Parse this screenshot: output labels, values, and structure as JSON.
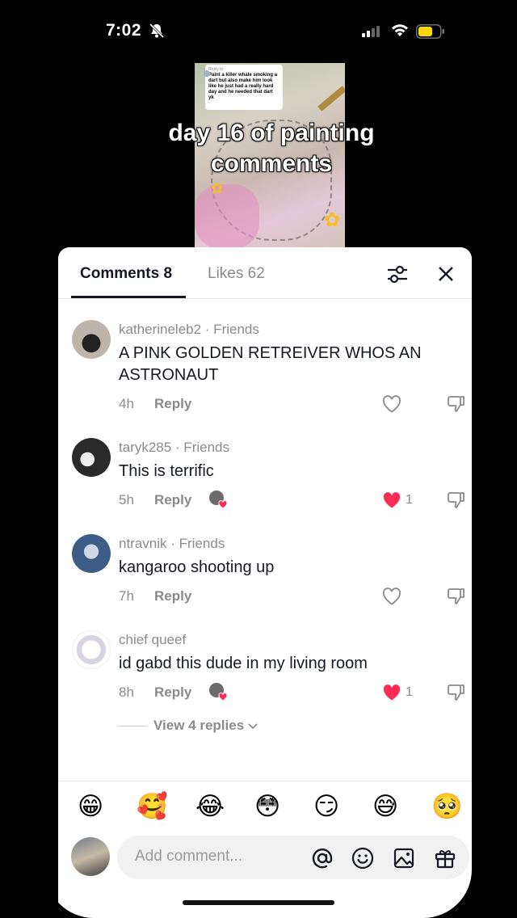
{
  "status": {
    "time": "7:02"
  },
  "video": {
    "overlay_line1": "day 16 of painting",
    "overlay_line2": "comments",
    "reply_label": "Reply to",
    "reply_text": "Paint a killer whale smoking a dart but also make him look like he just had a really hard day and he needed that dart yk"
  },
  "tabs": {
    "comments": "Comments 8",
    "likes": "Likes 62"
  },
  "comments": [
    {
      "user": "katherineleb2 · Friends",
      "text": "A PINK GOLDEN RETREIVER WHOS AN ASTRONAUT",
      "time": "4h",
      "reply": "Reply",
      "likes": ""
    },
    {
      "user": "taryk285 · Friends",
      "text": "This is terrific",
      "time": "5h",
      "reply": "Reply",
      "likes": "1"
    },
    {
      "user": "ntravnik · Friends",
      "text": "kangaroo shooting up",
      "time": "7h",
      "reply": "Reply",
      "likes": ""
    },
    {
      "user": "chief queef",
      "text": "id gabd this dude in my living room",
      "time": "8h",
      "reply": "Reply",
      "likes": "1"
    }
  ],
  "view_replies": "View 4 replies",
  "emoji_bar": [
    "😁",
    "🥰",
    "😂",
    "😳",
    "😏",
    "😅",
    "🥺"
  ],
  "composer": {
    "placeholder": "Add comment..."
  },
  "colors": {
    "heart_red": "#fe2c55",
    "text_dark": "#161823",
    "text_gray": "#8a8a8a"
  }
}
